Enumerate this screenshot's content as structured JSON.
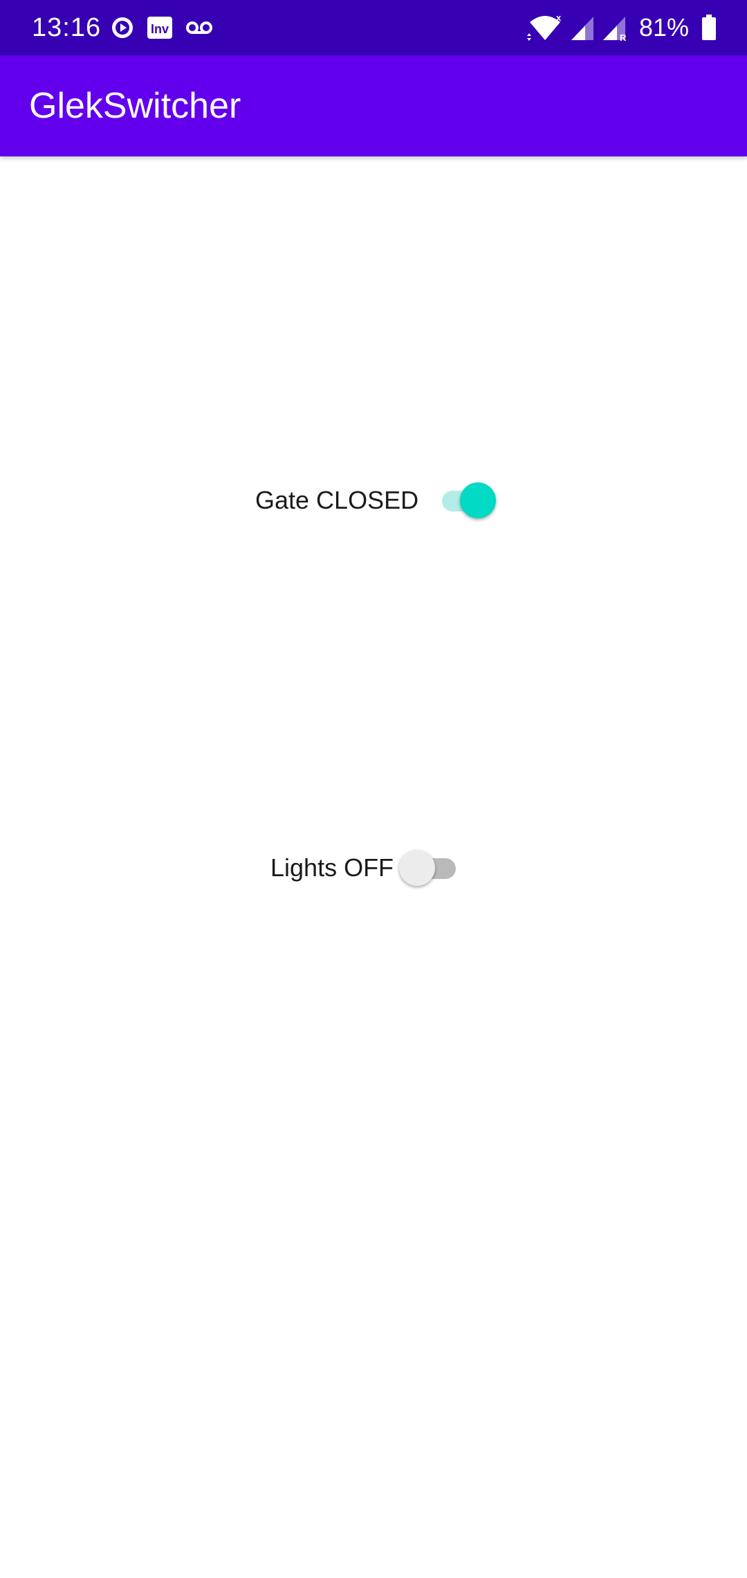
{
  "status_bar": {
    "time": "13:16",
    "battery_percent": "81%",
    "notification_icons": [
      "play-circle-icon",
      "inv-app-icon",
      "voicemail-icon"
    ],
    "system_icons": [
      "wifi-icon",
      "signal-icon",
      "signal-roaming-icon",
      "battery-icon"
    ],
    "background_color": "#3700B3"
  },
  "app_bar": {
    "title": "GlekSwitcher",
    "background_color": "#6200EE"
  },
  "controls": {
    "gate": {
      "label": "Gate CLOSED",
      "checked": true,
      "accent_color": "#03DAC5"
    },
    "lights": {
      "label": "Lights OFF",
      "checked": false
    }
  }
}
